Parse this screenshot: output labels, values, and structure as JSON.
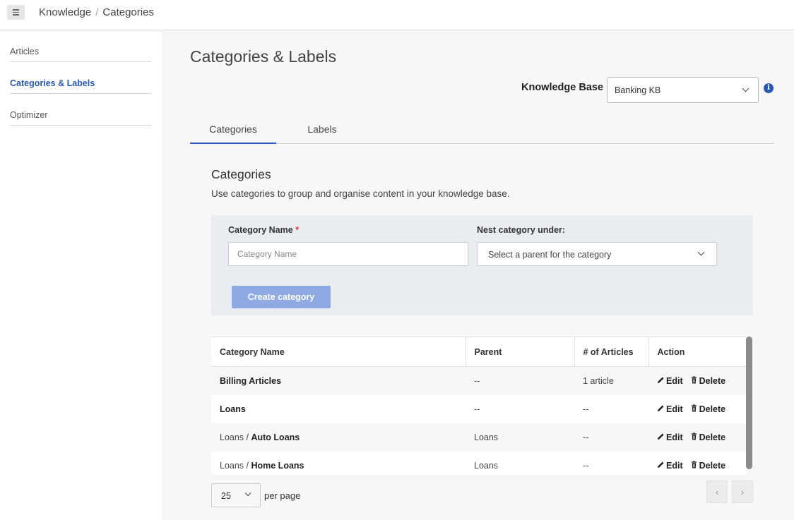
{
  "topbar": {
    "breadcrumb": [
      "Knowledge",
      "Categories"
    ],
    "breadcrumb_separator": "/",
    "menu_icon": "hamburger-icon"
  },
  "sidebar": {
    "items": [
      {
        "label": "Articles",
        "active": false
      },
      {
        "label": "Categories & Labels",
        "active": true
      },
      {
        "label": "Optimizer",
        "active": false
      }
    ]
  },
  "main": {
    "title": "Categories & Labels",
    "knowledge_base": {
      "label": "Knowledge Base",
      "selected": "Banking KB",
      "info_icon": "info-icon"
    },
    "tabs": [
      {
        "label": "Categories",
        "active": true
      },
      {
        "label": "Labels",
        "active": false
      }
    ],
    "section": {
      "title": "Categories",
      "description": "Use categories to group and organise content in your knowledge base."
    },
    "form": {
      "name_label": "Category Name",
      "required_mark": "*",
      "name_placeholder": "Category Name",
      "name_value": "",
      "nest_label": "Nest category under:",
      "nest_placeholder": "Select a parent for the category",
      "create_button": "Create category"
    },
    "table": {
      "columns": [
        "Category Name",
        "Parent",
        "# of Articles",
        "Action"
      ],
      "rows": [
        {
          "prefix": "",
          "name": "Billing Articles",
          "parent": "--",
          "articles": "1 article"
        },
        {
          "prefix": "",
          "name": "Loans",
          "parent": "--",
          "articles": "--"
        },
        {
          "prefix": "Loans / ",
          "name": "Auto Loans",
          "parent": "Loans",
          "articles": "--"
        },
        {
          "prefix": "Loans / ",
          "name": "Home Loans",
          "parent": "Loans",
          "articles": "--"
        }
      ],
      "edit_label": "Edit",
      "delete_label": "Delete"
    },
    "pagination": {
      "per_page_value": "25",
      "per_page_label": "per page",
      "prev_icon": "chevron-left-icon",
      "next_icon": "chevron-right-icon"
    }
  },
  "colors": {
    "accent": "#2a59b5",
    "button_disabled": "#8fa9e3",
    "form_background": "#e9ecf1",
    "page_background": "#f7f7f7",
    "required": "#dd3333"
  }
}
